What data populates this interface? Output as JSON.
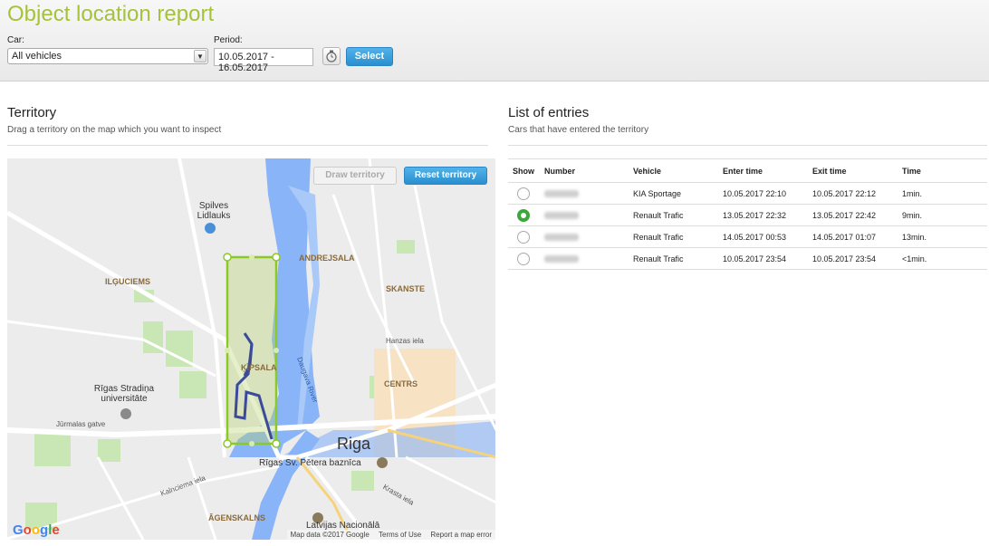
{
  "header": {
    "title": "Object location report",
    "car_label": "Car:",
    "car_value": "All vehicles",
    "period_label": "Period:",
    "period_value": "10.05.2017 - 16.05.2017",
    "select_label": "Select"
  },
  "territory": {
    "title": "Territory",
    "subtitle": "Drag a territory on the map which you want to inspect",
    "draw_label": "Draw territory",
    "reset_label": "Reset territory",
    "map": {
      "labels": [
        "Spilves Lidlauks",
        "ANDREJSALA",
        "SKANSTE",
        "ILĢUCIEMS",
        "ĶĪPSALA",
        "CENTRS",
        "Riga",
        "Rīgas Stradiņa universitāte",
        "Rīgas Sv. Pētera baznīca",
        "ĀGENSKALNS",
        "Latvijas Nacionālā",
        "Daugava River",
        "Jūrmalas gatve",
        "Kalnciema iela",
        "Hanzas iela",
        "Krasta iela"
      ],
      "google": "Google",
      "attribution": [
        "Map data ©2017 Google",
        "Terms of Use",
        "Report a map error"
      ]
    }
  },
  "entries": {
    "title": "List of entries",
    "subtitle": "Cars that have entered the territory",
    "columns": [
      "Show",
      "Number",
      "Vehicle",
      "Enter time",
      "Exit time",
      "Time"
    ],
    "rows": [
      {
        "selected": false,
        "vehicle": "KIA Sportage",
        "enter": "10.05.2017 22:10",
        "exit": "10.05.2017 22:12",
        "time": "1min."
      },
      {
        "selected": true,
        "vehicle": "Renault Trafic",
        "enter": "13.05.2017 22:32",
        "exit": "13.05.2017 22:42",
        "time": "9min."
      },
      {
        "selected": false,
        "vehicle": "Renault Trafic",
        "enter": "14.05.2017 00:53",
        "exit": "14.05.2017 01:07",
        "time": "13min."
      },
      {
        "selected": false,
        "vehicle": "Renault Trafic",
        "enter": "10.05.2017 23:54",
        "exit": "10.05.2017 23:54",
        "time": "<1min."
      }
    ]
  },
  "colors": {
    "accent_green": "#a5c23a",
    "button_blue": "#2a8fcf",
    "river": "#8ab4f8",
    "territory": "#8ac926"
  }
}
